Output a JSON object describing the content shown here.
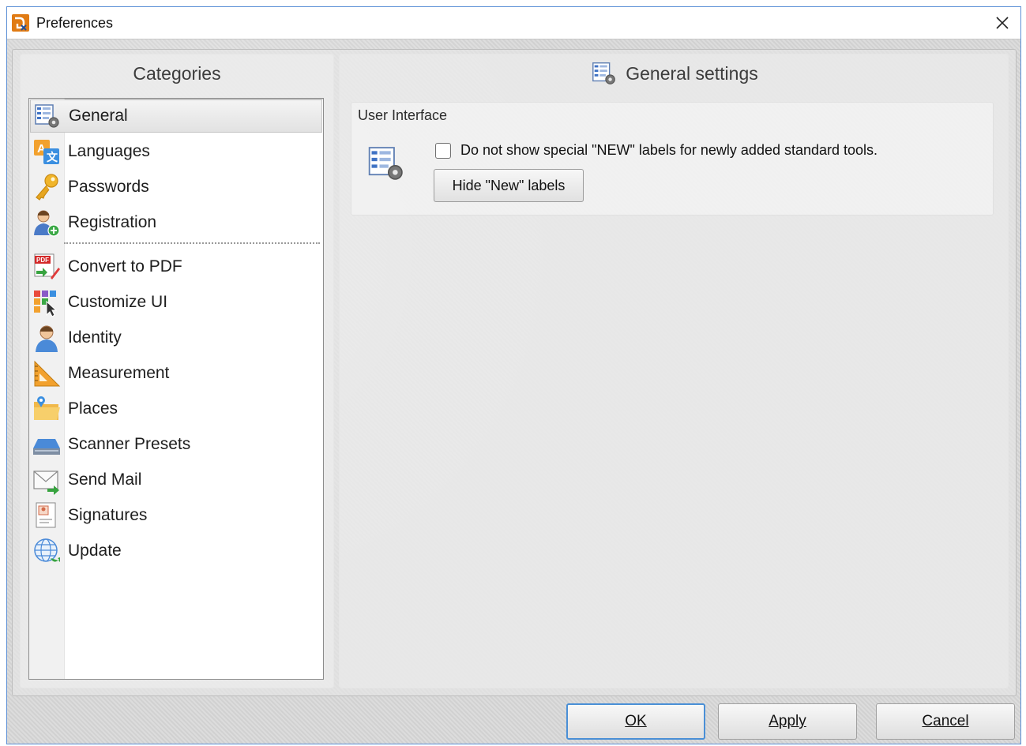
{
  "window": {
    "title": "Preferences",
    "app_icon": "pdf-xchange-logo-icon",
    "close_icon": "close-icon"
  },
  "categories": {
    "header": "Categories",
    "items": [
      {
        "label": "General",
        "icon": "general-settings-icon",
        "selected": true
      },
      {
        "label": "Languages",
        "icon": "languages-icon"
      },
      {
        "label": "Passwords",
        "icon": "key-icon"
      },
      {
        "label": "Registration",
        "icon": "user-add-icon"
      },
      {
        "label": "Convert to PDF",
        "icon": "convert-pdf-icon"
      },
      {
        "label": "Customize UI",
        "icon": "customize-ui-icon"
      },
      {
        "label": "Identity",
        "icon": "person-icon"
      },
      {
        "label": "Measurement",
        "icon": "ruler-triangle-icon"
      },
      {
        "label": "Places",
        "icon": "folder-places-icon"
      },
      {
        "label": "Scanner Presets",
        "icon": "scanner-icon"
      },
      {
        "label": "Send Mail",
        "icon": "envelope-icon"
      },
      {
        "label": "Signatures",
        "icon": "signature-certificate-icon"
      },
      {
        "label": "Update",
        "icon": "globe-update-icon"
      }
    ]
  },
  "settings": {
    "header": "General settings",
    "group": {
      "title": "User Interface",
      "checkbox_label": "Do not show special \"NEW\" labels for newly added standard tools.",
      "checkbox_checked": false,
      "button_label": "Hide \"New\" labels"
    }
  },
  "footer": {
    "ok": "OK",
    "apply": "Apply",
    "cancel": "Cancel"
  },
  "colors": {
    "accent": "#4a8fd6",
    "dialog_bg": "#d8d8d8",
    "list_bg": "#ffffff"
  }
}
